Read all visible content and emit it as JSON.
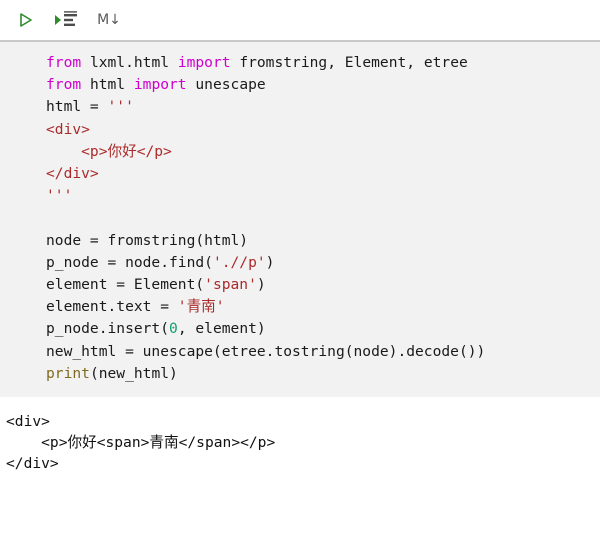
{
  "toolbar": {
    "run_cell_button": {
      "icon": "play-triangle-icon",
      "tooltip": "Run cell"
    },
    "run_cell_and_advance_button": {
      "icon": "run-and-step-icon",
      "tooltip": "Run cell and advance"
    },
    "markdown_button": {
      "icon": "markdown-icon",
      "label": "M↓",
      "tooltip": "Markdown"
    },
    "accent_green": "#2e8b2e",
    "label_gray": "#5a5a5a"
  },
  "editor": {
    "background": "#f2f2f2",
    "colors": {
      "keyword": "#cf00cf",
      "string": "#ab2b2b",
      "number": "#159e6a",
      "builtin": "#7f6a1f",
      "plain": "#1a1a1a"
    },
    "lines": [
      {
        "tokens": [
          {
            "t": "from ",
            "c": "kw"
          },
          {
            "t": "lxml.html ",
            "c": "plain"
          },
          {
            "t": "import ",
            "c": "kw"
          },
          {
            "t": "fromstring, Element, etree",
            "c": "plain"
          }
        ]
      },
      {
        "tokens": [
          {
            "t": "from ",
            "c": "kw"
          },
          {
            "t": "html ",
            "c": "plain"
          },
          {
            "t": "import ",
            "c": "kw"
          },
          {
            "t": "unescape",
            "c": "plain"
          }
        ]
      },
      {
        "tokens": [
          {
            "t": "html = ",
            "c": "plain"
          },
          {
            "t": "'''",
            "c": "str"
          }
        ]
      },
      {
        "tokens": [
          {
            "t": "<div>",
            "c": "str"
          }
        ]
      },
      {
        "tokens": [
          {
            "t": "    <p>你好</p>",
            "c": "str"
          }
        ]
      },
      {
        "tokens": [
          {
            "t": "</div>",
            "c": "str"
          }
        ]
      },
      {
        "tokens": [
          {
            "t": "'''",
            "c": "str"
          }
        ]
      },
      {
        "tokens": [
          {
            "t": "",
            "c": "plain"
          }
        ]
      },
      {
        "tokens": [
          {
            "t": "node = fromstring(html)",
            "c": "plain"
          }
        ]
      },
      {
        "tokens": [
          {
            "t": "p_node = node.find(",
            "c": "plain"
          },
          {
            "t": "'.//p'",
            "c": "str"
          },
          {
            "t": ")",
            "c": "plain"
          }
        ]
      },
      {
        "tokens": [
          {
            "t": "element = Element(",
            "c": "plain"
          },
          {
            "t": "'span'",
            "c": "str"
          },
          {
            "t": ")",
            "c": "plain"
          }
        ]
      },
      {
        "tokens": [
          {
            "t": "element.text = ",
            "c": "plain"
          },
          {
            "t": "'青南'",
            "c": "str"
          }
        ]
      },
      {
        "tokens": [
          {
            "t": "p_node.insert(",
            "c": "plain"
          },
          {
            "t": "0",
            "c": "num"
          },
          {
            "t": ", element)",
            "c": "plain"
          }
        ]
      },
      {
        "tokens": [
          {
            "t": "new_html = unescape(etree.tostring(node).decode())",
            "c": "plain"
          }
        ]
      },
      {
        "tokens": [
          {
            "t": "print",
            "c": "builtin"
          },
          {
            "t": "(new_html)",
            "c": "plain"
          }
        ]
      }
    ]
  },
  "output": {
    "background": "#ffffff",
    "text_color": "#111111",
    "lines": [
      "<div>",
      "    <p>你好<span>青南</span></p>",
      "</div>"
    ]
  }
}
